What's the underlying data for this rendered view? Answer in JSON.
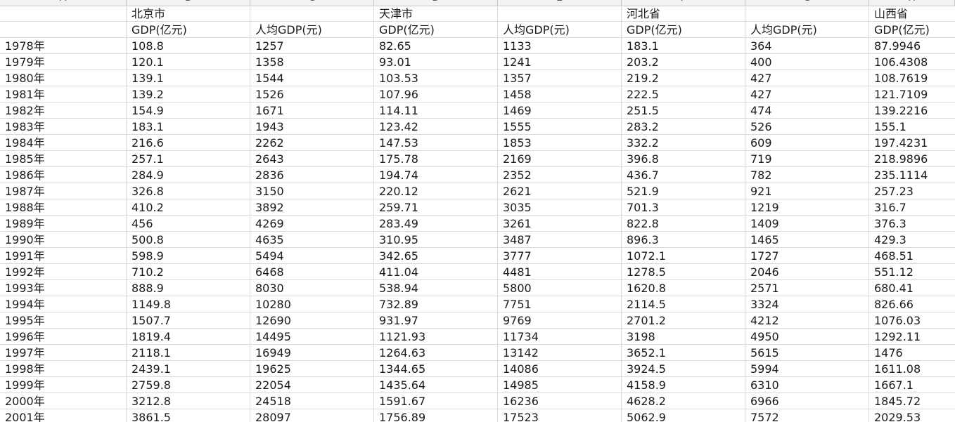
{
  "columns": [
    "A",
    "B",
    "C",
    "D",
    "E",
    "F",
    "G",
    "H"
  ],
  "region_row": [
    "",
    "北京市",
    "",
    "天津市",
    "",
    "河北省",
    "",
    "山西省"
  ],
  "metric_row": [
    "",
    "GDP(亿元)",
    "人均GDP(元)",
    "GDP(亿元)",
    "人均GDP(元)",
    "GDP(亿元)",
    "人均GDP(元)",
    "GDP(亿元)"
  ],
  "rows": [
    [
      "1978年",
      "108.8",
      "1257",
      "82.65",
      "1133",
      "183.1",
      "364",
      "87.9946"
    ],
    [
      "1979年",
      "120.1",
      "1358",
      "93.01",
      "1241",
      "203.2",
      "400",
      "106.4308"
    ],
    [
      "1980年",
      "139.1",
      "1544",
      "103.53",
      "1357",
      "219.2",
      "427",
      "108.7619"
    ],
    [
      "1981年",
      "139.2",
      "1526",
      "107.96",
      "1458",
      "222.5",
      "427",
      "121.7109"
    ],
    [
      "1982年",
      "154.9",
      "1671",
      "114.11",
      "1469",
      "251.5",
      "474",
      "139.2216"
    ],
    [
      "1983年",
      "183.1",
      "1943",
      "123.42",
      "1555",
      "283.2",
      "526",
      "155.1"
    ],
    [
      "1984年",
      "216.6",
      "2262",
      "147.53",
      "1853",
      "332.2",
      "609",
      "197.4231"
    ],
    [
      "1985年",
      "257.1",
      "2643",
      "175.78",
      "2169",
      "396.8",
      "719",
      "218.9896"
    ],
    [
      "1986年",
      "284.9",
      "2836",
      "194.74",
      "2352",
      "436.7",
      "782",
      "235.1114"
    ],
    [
      "1987年",
      "326.8",
      "3150",
      "220.12",
      "2621",
      "521.9",
      "921",
      "257.23"
    ],
    [
      "1988年",
      "410.2",
      "3892",
      "259.71",
      "3035",
      "701.3",
      "1219",
      "316.7"
    ],
    [
      "1989年",
      "456",
      "4269",
      "283.49",
      "3261",
      "822.8",
      "1409",
      "376.3"
    ],
    [
      "1990年",
      "500.8",
      "4635",
      "310.95",
      "3487",
      "896.3",
      "1465",
      "429.3"
    ],
    [
      "1991年",
      "598.9",
      "5494",
      "342.65",
      "3777",
      "1072.1",
      "1727",
      "468.51"
    ],
    [
      "1992年",
      "710.2",
      "6468",
      "411.04",
      "4481",
      "1278.5",
      "2046",
      "551.12"
    ],
    [
      "1993年",
      "888.9",
      "8030",
      "538.94",
      "5800",
      "1620.8",
      "2571",
      "680.41"
    ],
    [
      "1994年",
      "1149.8",
      "10280",
      "732.89",
      "7751",
      "2114.5",
      "3324",
      "826.66"
    ],
    [
      "1995年",
      "1507.7",
      "12690",
      "931.97",
      "9769",
      "2701.2",
      "4212",
      "1076.03"
    ],
    [
      "1996年",
      "1819.4",
      "14495",
      "1121.93",
      "11734",
      "3198",
      "4950",
      "1292.11"
    ],
    [
      "1997年",
      "2118.1",
      "16949",
      "1264.63",
      "13142",
      "3652.1",
      "5615",
      "1476"
    ],
    [
      "1998年",
      "2439.1",
      "19625",
      "1344.65",
      "14086",
      "3924.5",
      "5994",
      "1611.08"
    ],
    [
      "1999年",
      "2759.8",
      "22054",
      "1435.64",
      "14985",
      "4158.9",
      "6310",
      "1667.1"
    ],
    [
      "2000年",
      "3212.8",
      "24518",
      "1591.67",
      "16236",
      "4628.2",
      "6966",
      "1845.72"
    ],
    [
      "2001年",
      "3861.5",
      "28097",
      "1756.89",
      "17523",
      "5062.9",
      "7572",
      "2029.53"
    ]
  ]
}
